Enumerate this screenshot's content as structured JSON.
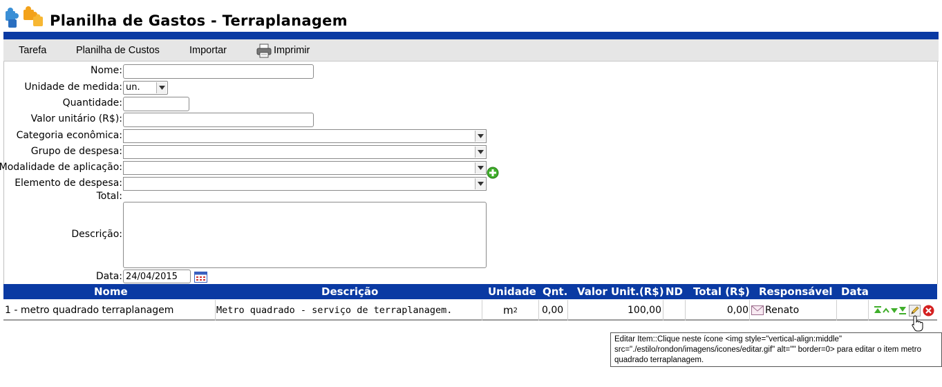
{
  "header": {
    "title": "Planilha de Gastos - Terraplanagem"
  },
  "menu": {
    "items": [
      "Tarefa",
      "Planilha de Custos",
      "Importar",
      "Imprimir"
    ]
  },
  "form": {
    "labels": {
      "nome": "Nome:",
      "unidade": "Unidade de medida:",
      "quantidade": "Quantidade:",
      "valor_unitario": "Valor unitário (R$):",
      "categoria": "Categoria econômica:",
      "grupo": "Grupo de despesa:",
      "modalidade": "Modalidade de aplicação:",
      "elemento": "Elemento de despesa:",
      "total": "Total:",
      "descricao": "Descrição:",
      "data": "Data:"
    },
    "values": {
      "nome": "",
      "unidade": "un.",
      "quantidade": "",
      "valor_unitario": "",
      "categoria": "",
      "grupo": "",
      "modalidade": "",
      "elemento": "",
      "descricao": "",
      "data": "24/04/2015"
    }
  },
  "table": {
    "headers": [
      "Nome",
      "Descrição",
      "Unidade",
      "Qnt.",
      "Valor Unit.(R$)",
      "ND",
      "Total (R$)",
      "Responsável",
      "Data"
    ],
    "rows": [
      {
        "nome": "1 - metro quadrado terraplanagem",
        "descricao": "Metro quadrado - serviço de terraplanagem.",
        "unidade": "m",
        "unidade_sup": "2",
        "qnt": "0,00",
        "valor_unit": "100,00",
        "nd": "",
        "total": "0,00",
        "responsavel": "Renato",
        "data": ""
      }
    ]
  },
  "tooltip": {
    "text": "Editar Item::Clique neste ícone <img style=\"vertical-align:middle\" src=\"./estilo/rondon/imagens/icones/editar.gif\" alt=\"\" border=0> para editar o item metro quadrado terraplanagem."
  },
  "colors": {
    "accent": "#0a3aa3",
    "menubar": "#e6e6e6",
    "add_green": "#3fae2a",
    "delete_red": "#d42020"
  }
}
